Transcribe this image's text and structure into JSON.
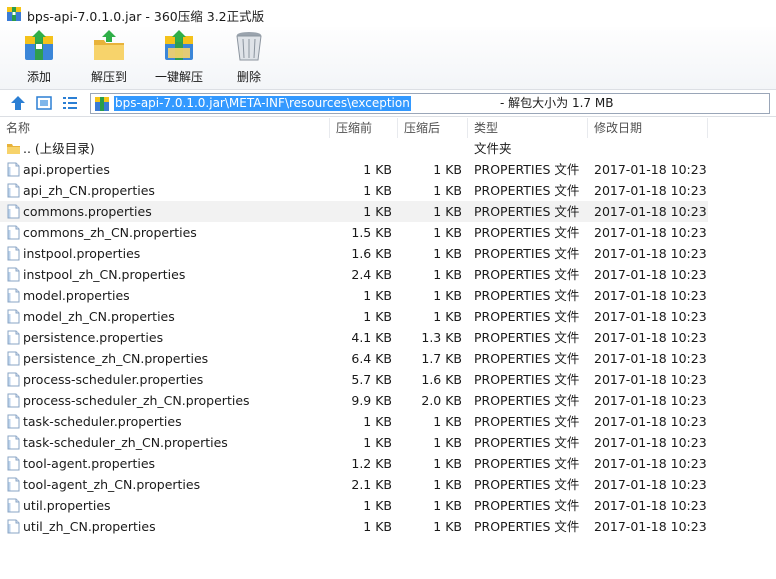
{
  "window": {
    "title": "bps-api-7.0.1.0.jar - 360压缩 3.2正式版"
  },
  "toolbar": {
    "add_label": "添加",
    "extract_to_label": "解压到",
    "one_click_extract_label": "一键解压",
    "delete_label": "删除"
  },
  "address": {
    "path": "bps-api-7.0.1.0.jar\\META-INF\\resources\\exception",
    "info": " - 解包大小为 1.7 MB"
  },
  "columns": {
    "name": "名称",
    "packed": "压缩前",
    "size": "压缩后",
    "type": "类型",
    "modified": "修改日期"
  },
  "parent_row": {
    "name": ".. (上级目录)",
    "type": "文件夹"
  },
  "files": [
    {
      "name": "api.properties",
      "packed": "1 KB",
      "size": "1 KB",
      "type": "PROPERTIES 文件",
      "modified": "2017-01-18 10:23"
    },
    {
      "name": "api_zh_CN.properties",
      "packed": "1 KB",
      "size": "1 KB",
      "type": "PROPERTIES 文件",
      "modified": "2017-01-18 10:23"
    },
    {
      "name": "commons.properties",
      "packed": "1 KB",
      "size": "1 KB",
      "type": "PROPERTIES 文件",
      "modified": "2017-01-18 10:23"
    },
    {
      "name": "commons_zh_CN.properties",
      "packed": "1.5 KB",
      "size": "1 KB",
      "type": "PROPERTIES 文件",
      "modified": "2017-01-18 10:23"
    },
    {
      "name": "instpool.properties",
      "packed": "1.6 KB",
      "size": "1 KB",
      "type": "PROPERTIES 文件",
      "modified": "2017-01-18 10:23"
    },
    {
      "name": "instpool_zh_CN.properties",
      "packed": "2.4 KB",
      "size": "1 KB",
      "type": "PROPERTIES 文件",
      "modified": "2017-01-18 10:23"
    },
    {
      "name": "model.properties",
      "packed": "1 KB",
      "size": "1 KB",
      "type": "PROPERTIES 文件",
      "modified": "2017-01-18 10:23"
    },
    {
      "name": "model_zh_CN.properties",
      "packed": "1 KB",
      "size": "1 KB",
      "type": "PROPERTIES 文件",
      "modified": "2017-01-18 10:23"
    },
    {
      "name": "persistence.properties",
      "packed": "4.1 KB",
      "size": "1.3 KB",
      "type": "PROPERTIES 文件",
      "modified": "2017-01-18 10:23"
    },
    {
      "name": "persistence_zh_CN.properties",
      "packed": "6.4 KB",
      "size": "1.7 KB",
      "type": "PROPERTIES 文件",
      "modified": "2017-01-18 10:23"
    },
    {
      "name": "process-scheduler.properties",
      "packed": "5.7 KB",
      "size": "1.6 KB",
      "type": "PROPERTIES 文件",
      "modified": "2017-01-18 10:23"
    },
    {
      "name": "process-scheduler_zh_CN.properties",
      "packed": "9.9 KB",
      "size": "2.0 KB",
      "type": "PROPERTIES 文件",
      "modified": "2017-01-18 10:23"
    },
    {
      "name": "task-scheduler.properties",
      "packed": "1 KB",
      "size": "1 KB",
      "type": "PROPERTIES 文件",
      "modified": "2017-01-18 10:23"
    },
    {
      "name": "task-scheduler_zh_CN.properties",
      "packed": "1 KB",
      "size": "1 KB",
      "type": "PROPERTIES 文件",
      "modified": "2017-01-18 10:23"
    },
    {
      "name": "tool-agent.properties",
      "packed": "1.2 KB",
      "size": "1 KB",
      "type": "PROPERTIES 文件",
      "modified": "2017-01-18 10:23"
    },
    {
      "name": "tool-agent_zh_CN.properties",
      "packed": "2.1 KB",
      "size": "1 KB",
      "type": "PROPERTIES 文件",
      "modified": "2017-01-18 10:23"
    },
    {
      "name": "util.properties",
      "packed": "1 KB",
      "size": "1 KB",
      "type": "PROPERTIES 文件",
      "modified": "2017-01-18 10:23"
    },
    {
      "name": "util_zh_CN.properties",
      "packed": "1 KB",
      "size": "1 KB",
      "type": "PROPERTIES 文件",
      "modified": "2017-01-18 10:23"
    }
  ],
  "hovered_row_index": 2,
  "icons": {
    "title": "archive-icon",
    "add": "add-files-icon",
    "extract_to": "extract-folder-icon",
    "one_click_extract": "one-click-extract-icon",
    "delete": "recycle-bin-icon",
    "up": "up-arrow-icon",
    "thumbnail_view": "thumbnail-view-icon",
    "list_view": "list-view-icon",
    "folder": "folder-icon",
    "file": "properties-file-icon"
  },
  "colors": {
    "address_selection": "#3399ff",
    "hover_row": "#f2f2f2",
    "up_arrow": "#2b7fd4"
  }
}
